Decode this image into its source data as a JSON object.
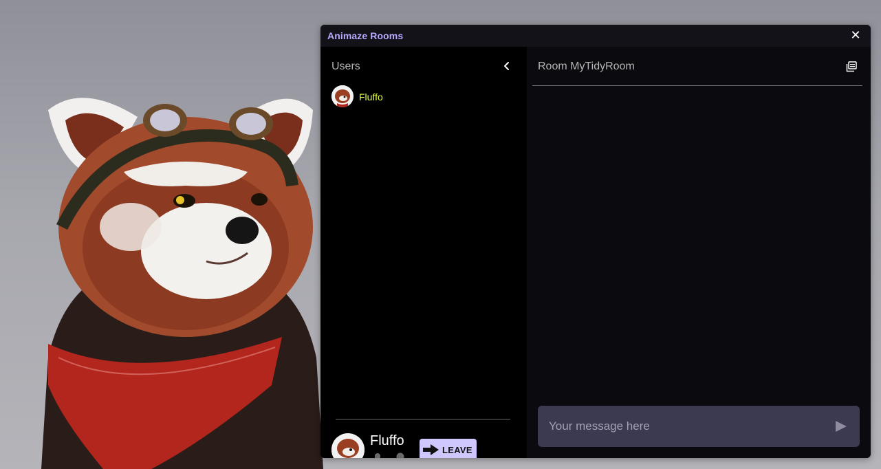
{
  "window": {
    "title": "Animaze Rooms",
    "close_glyph": "✕"
  },
  "users_panel": {
    "header": "Users",
    "users": [
      {
        "name": "Fluffo",
        "name_color": "#e6ff3c"
      }
    ]
  },
  "self": {
    "name": "Fluffo",
    "leave_label": "LEAVE",
    "icons": [
      "microphone-icon",
      "person-icon",
      "arrow-right-icon"
    ]
  },
  "chat": {
    "room_title": "Room MyTidyRoom",
    "input_placeholder": "Your message here",
    "input_value": ""
  },
  "colors": {
    "accent": "#b8a9ff",
    "leave_button": "#cfc8ff",
    "input_bg": "#3c3a50",
    "panel_dark": "#000000",
    "chat_bg": "#0b0a0e"
  }
}
